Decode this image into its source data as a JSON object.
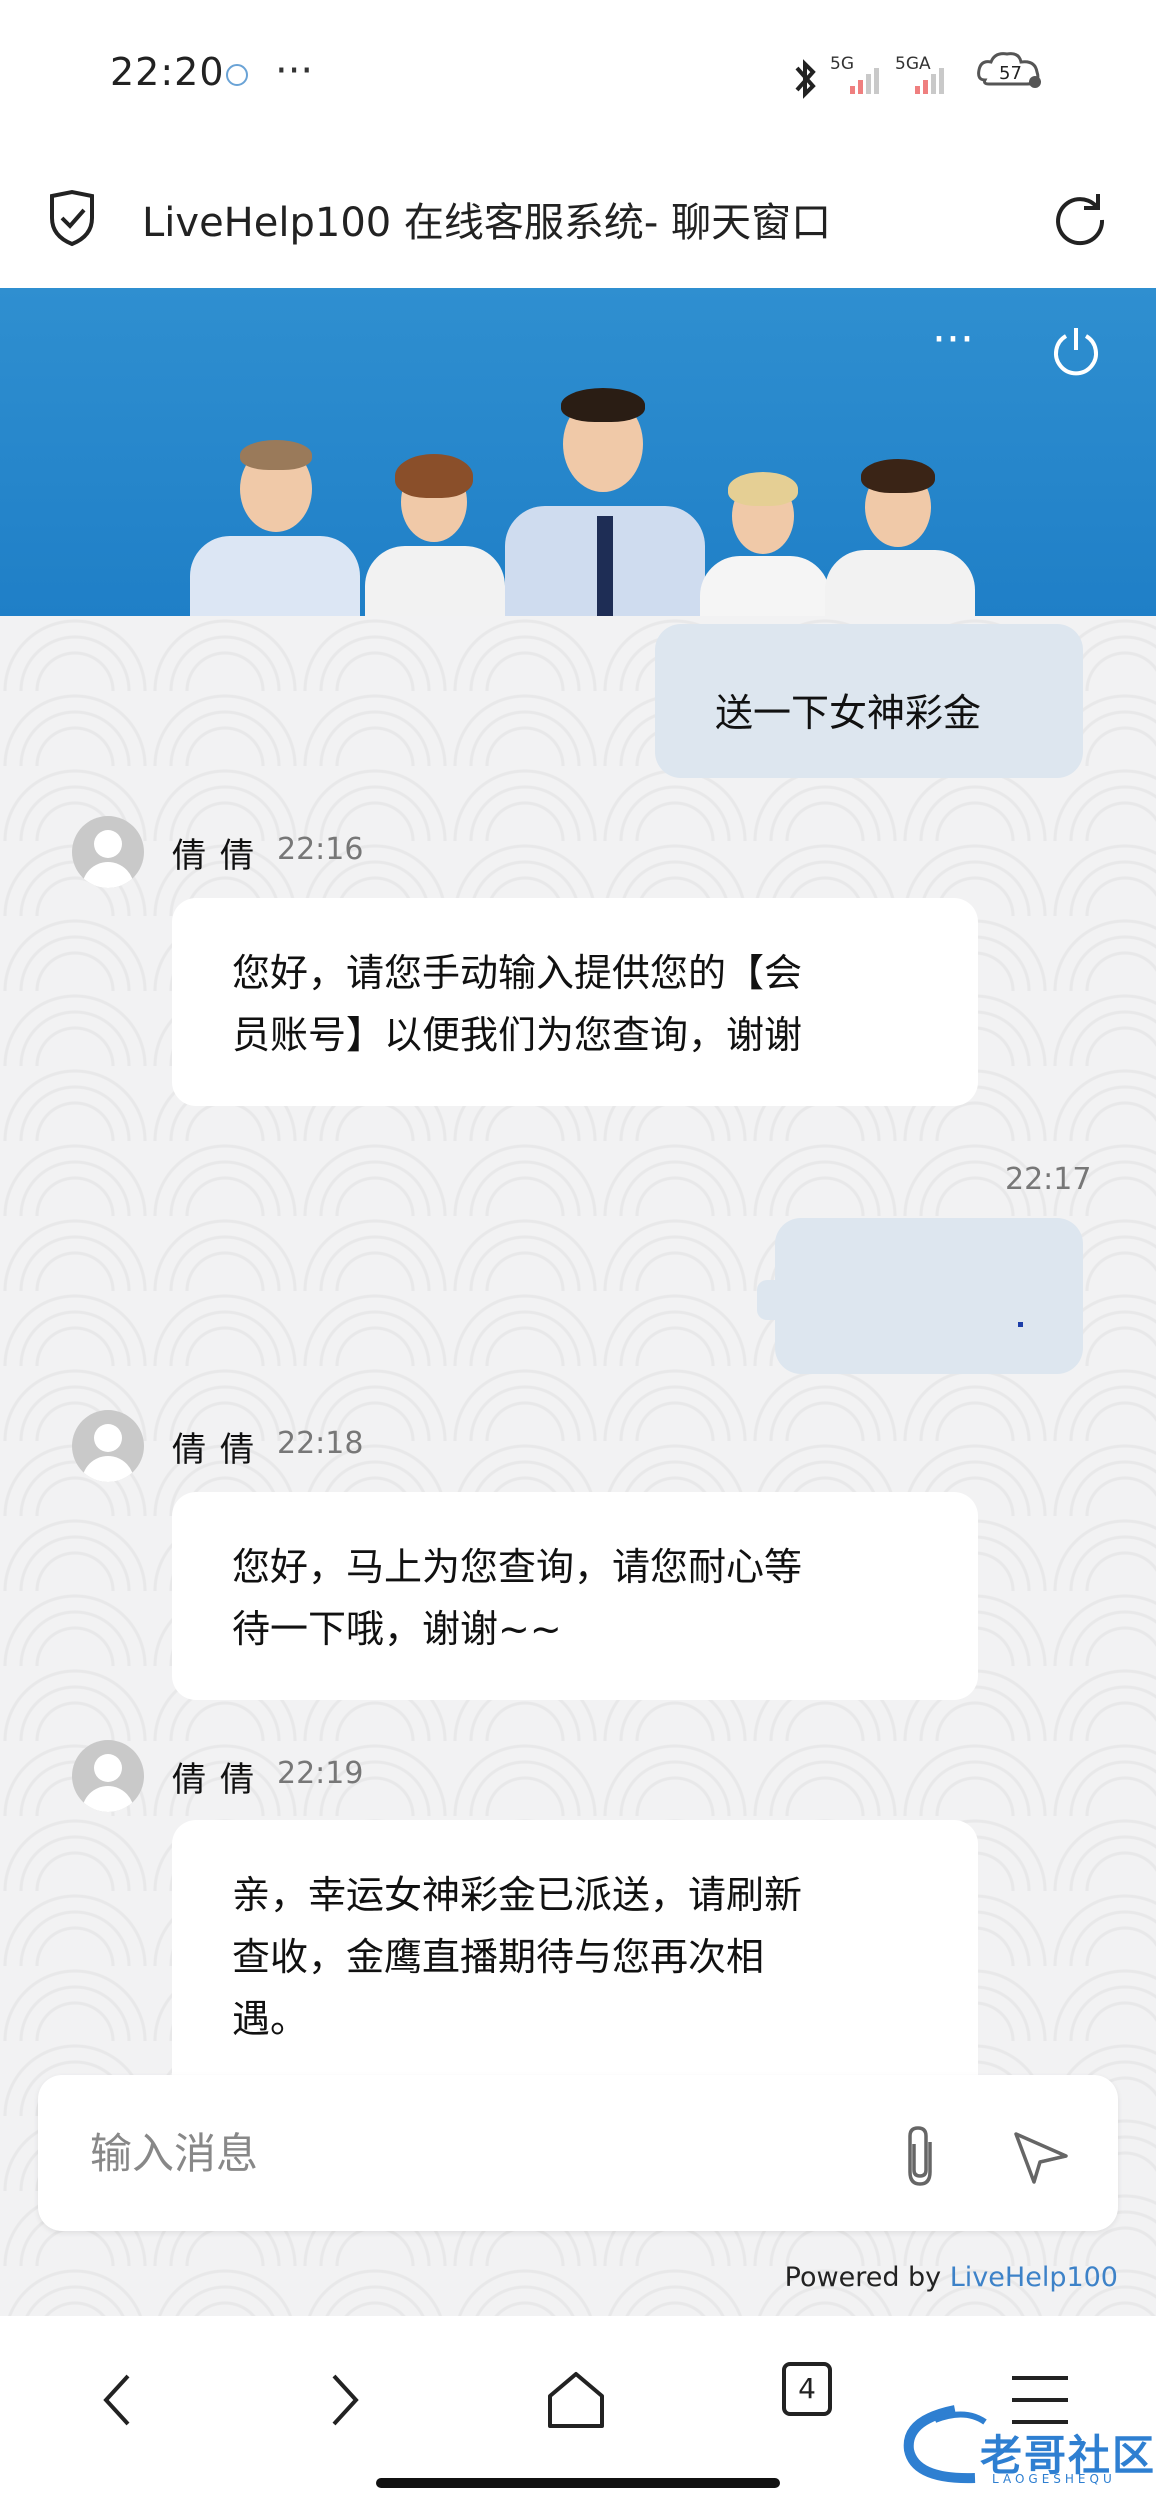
{
  "status_bar": {
    "time": "22:20",
    "dots": "···",
    "network1": "5G",
    "network2": "5GA",
    "battery": "57"
  },
  "title_bar": {
    "title": "LiveHelp100 在线客服系统- 聊天窗口"
  },
  "header": {
    "more_glyph": "···"
  },
  "messages": [
    {
      "type": "outgoing",
      "text": "送一下女神彩金"
    },
    {
      "type": "incoming",
      "agent": "倩倩",
      "time": "22:16",
      "lines": [
        "您好，请您手动输入提供您的【会",
        "员账号】以便我们为您查询，谢谢"
      ]
    },
    {
      "type": "outgoing",
      "time": "22:17",
      "text": "",
      "redacted": true
    },
    {
      "type": "incoming",
      "agent": "倩倩",
      "time": "22:18",
      "lines": [
        "您好，马上为您查询，请您耐心等",
        "待一下哦，谢谢~~"
      ]
    },
    {
      "type": "incoming",
      "agent": "倩倩",
      "time": "22:19",
      "lines": [
        "亲，幸运女神彩金已派送，请刷新",
        "查收，金鹰直播期待与您再次相",
        "遇。"
      ]
    }
  ],
  "composer": {
    "placeholder": "输入消息"
  },
  "footer": {
    "powered_by": "Powered by",
    "brand": "LiveHelp100"
  },
  "bottom_nav": {
    "tab_count": "4"
  },
  "watermark": {
    "text": "老哥社区",
    "sub": "LAOGESHEQU"
  },
  "colors": {
    "banner": "#2f8fd0",
    "outgoing_bubble": "#dde6ef",
    "incoming_bubble": "#ffffff",
    "link": "#3d82c8"
  }
}
